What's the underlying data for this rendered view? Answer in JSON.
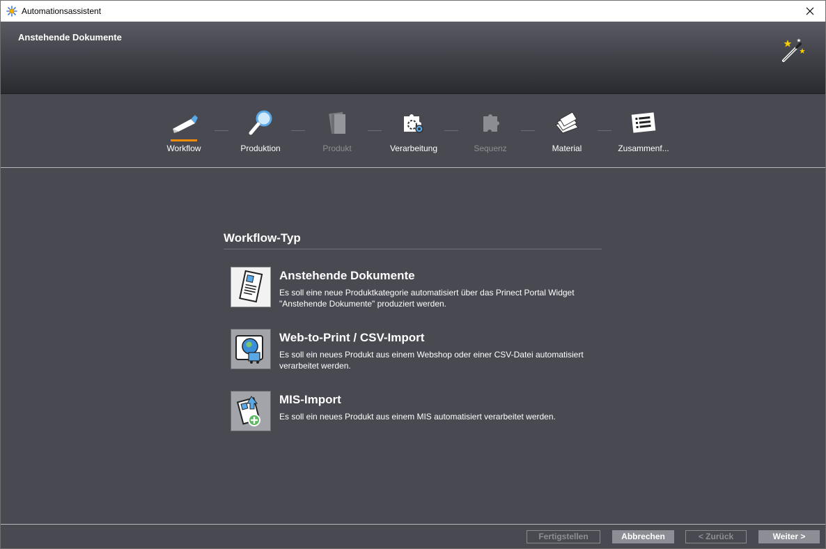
{
  "window": {
    "title": "Automationsassistent"
  },
  "header": {
    "title": "Anstehende Dokumente"
  },
  "steps": [
    {
      "label": "Workflow",
      "state": "active"
    },
    {
      "label": "Produktion",
      "state": "enabled"
    },
    {
      "label": "Produkt",
      "state": "disabled"
    },
    {
      "label": "Verarbeitung",
      "state": "enabled"
    },
    {
      "label": "Sequenz",
      "state": "disabled"
    },
    {
      "label": "Material",
      "state": "enabled"
    },
    {
      "label": "Zusammenf...",
      "state": "enabled"
    }
  ],
  "section": {
    "title": "Workflow-Typ"
  },
  "options": [
    {
      "title": "Anstehende Dokumente",
      "description_line1": "Es soll eine neue Produktkategorie automatisiert über das Prinect Portal Widget",
      "description_line2": "\"Anstehende Dokumente\" produziert werden.",
      "icon": "pending-documents-icon"
    },
    {
      "title": "Web-to-Print / CSV-Import",
      "description_line1": "Es soll ein neues Produkt aus einem Webshop oder einer CSV-Datei automatisiert",
      "description_line2": "verarbeitet werden.",
      "icon": "web-shop-icon"
    },
    {
      "title": "MIS-Import",
      "description_line1": "Es soll ein neues Produkt aus einem MIS automatisiert verarbeitet werden.",
      "description_line2": "",
      "icon": "mis-import-icon"
    }
  ],
  "footer": {
    "finish_label": "Fertigstellen",
    "cancel_label": "Abbrechen",
    "back_label": "< Zurück",
    "next_label": "Weiter >"
  },
  "colors": {
    "accent": "#f08c00",
    "background": "#484951",
    "header_top": "#5a5b63"
  }
}
